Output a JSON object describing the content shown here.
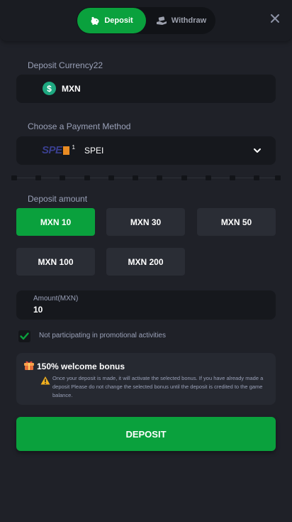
{
  "header": {
    "tab_deposit": "Deposit",
    "tab_withdraw": "Withdraw",
    "active_tab": "deposit"
  },
  "currency": {
    "label": "Deposit Currency22",
    "value": "MXN",
    "icon": "dollar-coin-icon"
  },
  "payment": {
    "label": "Choose a Payment Method",
    "logo_text": "SPE",
    "logo_superscript": "1",
    "value": "SPEI"
  },
  "amount": {
    "label": "Deposit amount",
    "options": [
      "MXN 10",
      "MXN 30",
      "MXN 50",
      "MXN 100",
      "MXN 200"
    ],
    "selected_index": 0,
    "input_caption": "Amount(MXN)",
    "input_value": "10"
  },
  "promo": {
    "checked": true,
    "label": "Not participating in promotional activities"
  },
  "bonus": {
    "title": "150% welcome bonus",
    "text": "Once your deposit is made, it will activate the selected bonus. If you have already made a deposit Please do not change the selected bonus until the deposit is credited to the game balance."
  },
  "submit_label": "DEPOSIT",
  "colors": {
    "accent": "#0aa13d",
    "background": "#1f2128",
    "field": "#16181d"
  }
}
